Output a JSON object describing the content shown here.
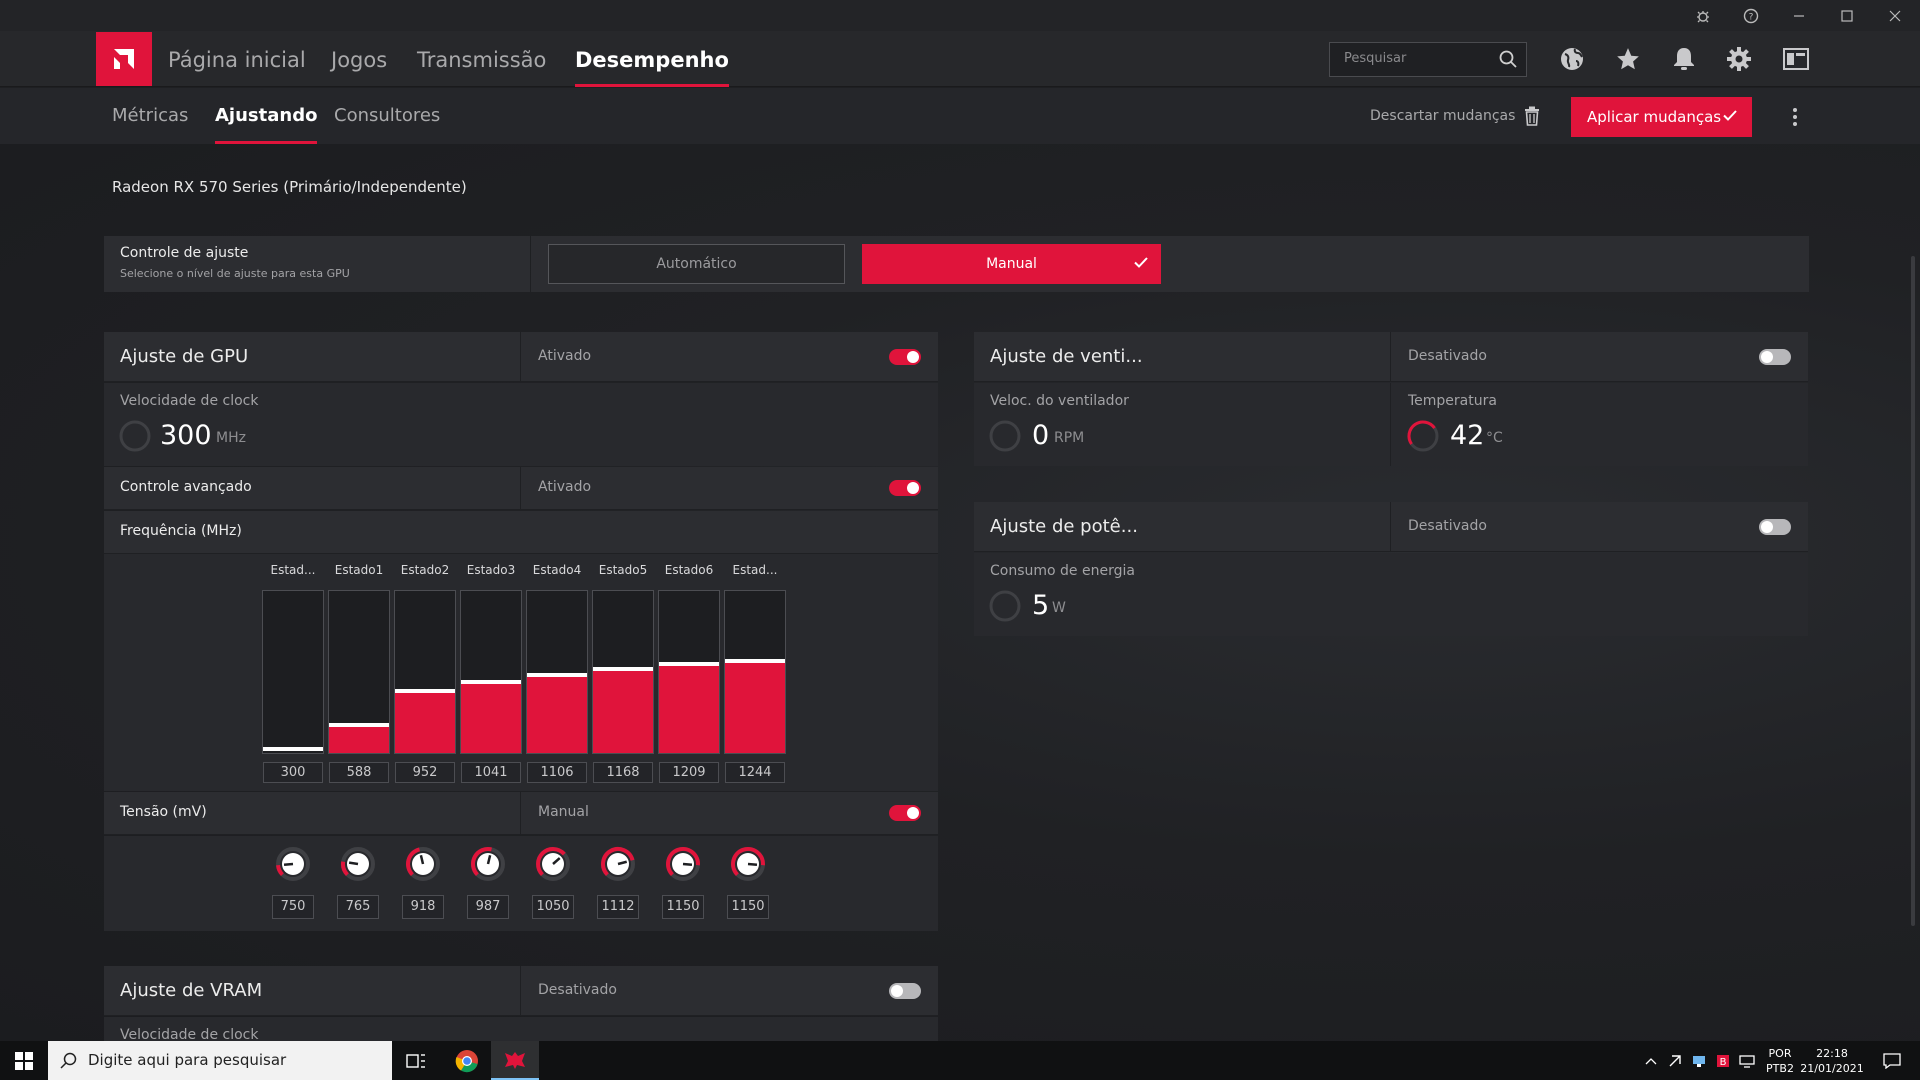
{
  "window": {
    "controls": [
      "bug-icon",
      "help-icon",
      "minimize-icon",
      "maximize-icon",
      "close-icon"
    ]
  },
  "nav": {
    "tabs": [
      "Página inicial",
      "Jogos",
      "Transmissão",
      "Desempenho"
    ],
    "active_tab": "Desempenho",
    "search_placeholder": "Pesquisar",
    "icons": [
      "globe-icon",
      "star-icon",
      "bell-icon",
      "gear-icon",
      "layout-icon"
    ]
  },
  "subnav": {
    "tabs": [
      "Métricas",
      "Ajustando",
      "Consultores"
    ],
    "active_tab": "Ajustando",
    "discard_label": "Descartar mudanças",
    "apply_label": "Aplicar mudanças"
  },
  "gpu_name": "Radeon RX 570 Series (Primário/Independente)",
  "tuning_control": {
    "title": "Controle de ajuste",
    "subtitle": "Selecione o nível de ajuste para esta GPU",
    "options": [
      "Automático",
      "Manual"
    ],
    "selected": "Manual"
  },
  "gpu_tuning": {
    "title": "Ajuste de GPU",
    "status": "Ativado",
    "enabled": true,
    "clock_label": "Velocidade de clock",
    "clock_value": "300",
    "clock_unit": "MHz",
    "advanced_label": "Controle avançado",
    "advanced_status": "Ativado",
    "advanced_enabled": true,
    "frequency_label": "Frequência (MHz)",
    "states": [
      {
        "label": "Estad...",
        "freq": "300",
        "fill": 0.0
      },
      {
        "label": "Estado1",
        "freq": "588",
        "fill": 0.17
      },
      {
        "label": "Estado2",
        "freq": "952",
        "fill": 0.38
      },
      {
        "label": "Estado3",
        "freq": "1041",
        "fill": 0.44
      },
      {
        "label": "Estado4",
        "freq": "1106",
        "fill": 0.48
      },
      {
        "label": "Estado5",
        "freq": "1168",
        "fill": 0.52
      },
      {
        "label": "Estado6",
        "freq": "1209",
        "fill": 0.55
      },
      {
        "label": "Estad...",
        "freq": "1244",
        "fill": 0.57
      }
    ],
    "voltage_label": "Tensão (mV)",
    "voltage_status": "Manual",
    "voltage_enabled": true,
    "voltages": [
      {
        "value": "750",
        "level": 0.15
      },
      {
        "value": "765",
        "level": 0.2
      },
      {
        "value": "918",
        "level": 0.45
      },
      {
        "value": "987",
        "level": 0.55
      },
      {
        "value": "1050",
        "level": 0.68
      },
      {
        "value": "1112",
        "level": 0.78
      },
      {
        "value": "1150",
        "level": 0.85
      },
      {
        "value": "1150",
        "level": 0.85
      }
    ]
  },
  "vram_tuning": {
    "title": "Ajuste de VRAM",
    "status": "Desativado",
    "enabled": false,
    "clock_label": "Velocidade de clock"
  },
  "fan_tuning": {
    "title": "Ajuste de venti...",
    "status": "Desativado",
    "enabled": false,
    "fan_label": "Veloc. do ventilador",
    "fan_value": "0",
    "fan_unit": "RPM",
    "temp_label": "Temperatura",
    "temp_value": "42",
    "temp_unit": "°C"
  },
  "power_tuning": {
    "title": "Ajuste de potê...",
    "status": "Desativado",
    "enabled": false,
    "power_label": "Consumo de energia",
    "power_value": "5",
    "power_unit": "W"
  },
  "taskbar": {
    "search_placeholder": "Digite aqui para pesquisar",
    "lang_top": "POR",
    "lang_bottom": "PTB2",
    "time": "22:18",
    "date": "21/01/2021"
  },
  "colors": {
    "accent": "#e0143b",
    "panel": "#2c2d31",
    "background": "#1e1f22"
  }
}
